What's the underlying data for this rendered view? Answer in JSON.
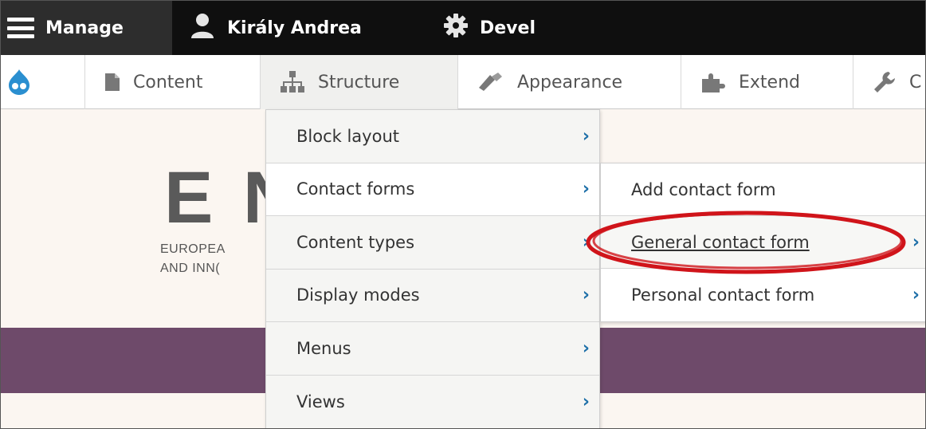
{
  "toolbar": {
    "manage_label": "Manage",
    "user_label": "Király Andrea",
    "devel_label": "Devel"
  },
  "tray": {
    "items": [
      {
        "label": "Content",
        "icon": "page-icon"
      },
      {
        "label": "Structure",
        "icon": "sitemap-icon"
      },
      {
        "label": "Appearance",
        "icon": "brush-icon"
      },
      {
        "label": "Extend",
        "icon": "puzzle-icon"
      },
      {
        "label": "C",
        "icon": "wrench-icon"
      }
    ]
  },
  "site": {
    "logo_text": "E N",
    "slogan_line1": "EUROPEA",
    "slogan_line2": "AND INN("
  },
  "structure_menu": {
    "items": [
      {
        "label": "Block layout"
      },
      {
        "label": "Contact forms"
      },
      {
        "label": "Content types"
      },
      {
        "label": "Display modes"
      },
      {
        "label": "Menus"
      },
      {
        "label": "Views"
      }
    ]
  },
  "contact_submenu": {
    "items": [
      {
        "label": "Add contact form"
      },
      {
        "label": "General contact form"
      },
      {
        "label": "Personal contact form"
      }
    ]
  },
  "colors": {
    "toolbar_bg": "#0f0f0f",
    "manage_bg": "#2d2d2d",
    "purple_band": "#6e4a6a",
    "chevron": "#1d6fa8",
    "highlight_ring": "#d0141a"
  }
}
